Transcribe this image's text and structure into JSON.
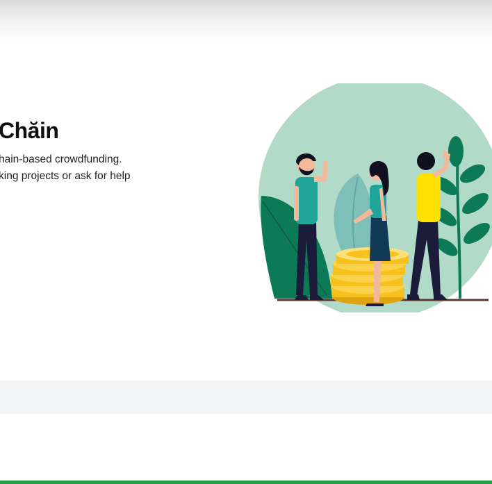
{
  "hero": {
    "title": "Chăin",
    "line1": "hain-based crowdfunding.",
    "line2": "king projects or ask for help"
  },
  "colors": {
    "circle": "#b1dac8",
    "leaf_dark": "#0d7a57",
    "leaf_light": "#7fbfb9",
    "shirt_teal": "#21a59b",
    "shirt_yellow": "#ffe000",
    "pants_navy": "#1b1c3a",
    "coin": "#f7c21d",
    "coin_shadow": "#e0a411",
    "ground": "#5b3a33",
    "footer_band": "#f3f4f6",
    "accent_bar": "#22a04b"
  }
}
